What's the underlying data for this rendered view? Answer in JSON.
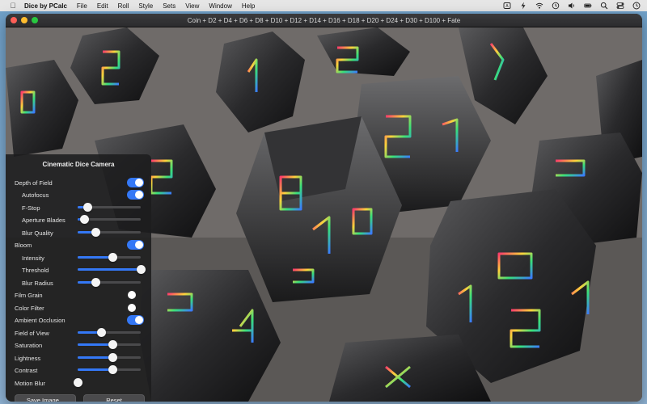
{
  "menubar": {
    "app_name": "Dice by PCalc",
    "items": [
      "File",
      "Edit",
      "Roll",
      "Style",
      "Sets",
      "View",
      "Window",
      "Help"
    ]
  },
  "window": {
    "title": "Coin + D2 + D4 + D6 + D8 + D10 + D12 + D14 + D16 + D18 + D20 + D24 + D30 + D100 + Fate"
  },
  "panel": {
    "title": "Cinematic Dice Camera",
    "controls": [
      {
        "label": "Depth of Field",
        "kind": "toggle",
        "on": true
      },
      {
        "label": "Autofocus",
        "kind": "toggle",
        "on": true
      },
      {
        "label": "F-Stop",
        "kind": "slider",
        "value": 0.15
      },
      {
        "label": "Aperture Blades",
        "kind": "slider",
        "value": 0.1
      },
      {
        "label": "Blur Quality",
        "kind": "slider",
        "value": 0.28
      },
      {
        "label": "Bloom",
        "kind": "toggle",
        "on": true
      },
      {
        "label": "Intensity",
        "kind": "slider",
        "value": 0.55
      },
      {
        "label": "Threshold",
        "kind": "slider",
        "value": 1.0
      },
      {
        "label": "Blur Radius",
        "kind": "slider",
        "value": 0.28
      },
      {
        "label": "Film Grain",
        "kind": "toggle",
        "on": false
      },
      {
        "label": "Color Filter",
        "kind": "toggle",
        "on": false
      },
      {
        "label": "Ambient Occlusion",
        "kind": "toggle",
        "on": true
      },
      {
        "label": "Field of View",
        "kind": "slider",
        "value": 0.37
      },
      {
        "label": "Saturation",
        "kind": "slider",
        "value": 0.55
      },
      {
        "label": "Lightness",
        "kind": "slider",
        "value": 0.55
      },
      {
        "label": "Contrast",
        "kind": "slider",
        "value": 0.55
      },
      {
        "label": "Motion Blur",
        "kind": "toggle",
        "on": false
      }
    ],
    "save_label": "Save Image...",
    "reset_label": "Reset"
  },
  "colors": {
    "accent": "#3478f6",
    "panel_bg": "#1c1c1e"
  }
}
